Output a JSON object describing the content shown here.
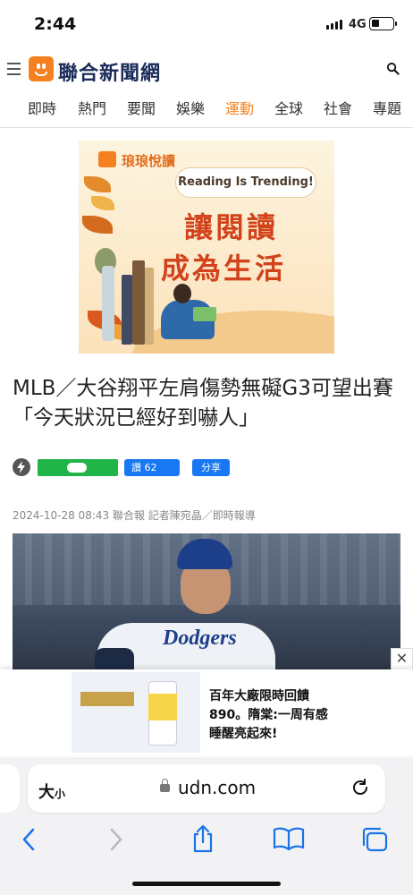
{
  "status": {
    "time": "2:44",
    "network": "4G"
  },
  "header": {
    "logo_text": "聯合新聞網"
  },
  "nav": {
    "items": [
      {
        "label": "即時",
        "active": false
      },
      {
        "label": "熱門",
        "active": false
      },
      {
        "label": "要聞",
        "active": false
      },
      {
        "label": "娛樂",
        "active": false
      },
      {
        "label": "運動",
        "active": true
      },
      {
        "label": "全球",
        "active": false
      },
      {
        "label": "社會",
        "active": false
      },
      {
        "label": "專題",
        "active": false
      }
    ],
    "active_color": "#f5801f"
  },
  "banner": {
    "brand": "琅琅悅讀",
    "bubble": "Reading Is Trending!",
    "line1": "讓閱讀",
    "line2": "成為生活"
  },
  "article": {
    "title": "MLB／大谷翔平左肩傷勢無礙G3可望出賽 「今天狀況已經好到嚇人」",
    "share": {
      "like_label": "讚 62",
      "share_label": "分享"
    },
    "meta": "2024-10-28 08:43 聯合報 記者陳宛晶／即時報導"
  },
  "floating_ad": {
    "line1": "百年大廠限時回饋",
    "line2": "890。隋棠:一周有感",
    "line3": "睡醒亮起來!",
    "close": "✕"
  },
  "browser": {
    "aa": "大",
    "aa_small": "小",
    "host": "udn.com"
  }
}
